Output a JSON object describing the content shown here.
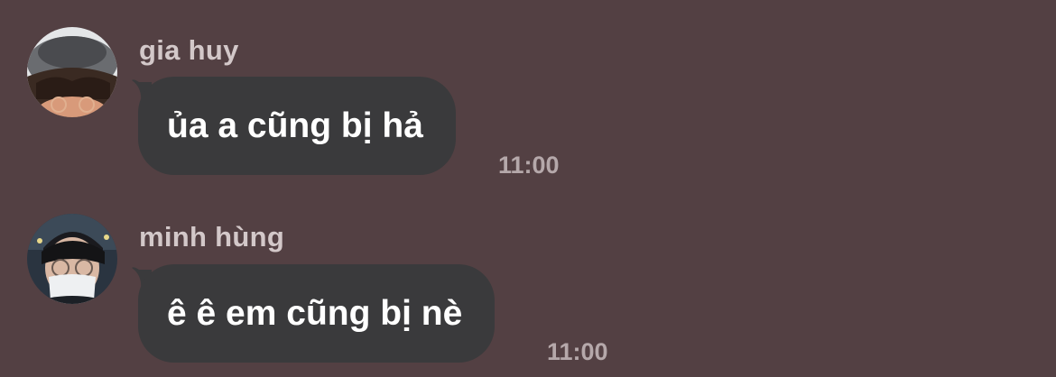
{
  "messages": [
    {
      "sender": "gia huy",
      "avatar": "avatar-gia-huy",
      "text": "ủa a cũng bị hả",
      "time": "11:00"
    },
    {
      "sender": "minh hùng",
      "avatar": "avatar-minh-hung",
      "text": "ê ê em cũng bị nè",
      "time": "11:00"
    }
  ],
  "colors": {
    "background": "#534043",
    "bubble": "#3a3a3c",
    "sender_text": "#d3c8c9",
    "time_text": "#b5a8aa",
    "message_text": "#ffffff"
  }
}
